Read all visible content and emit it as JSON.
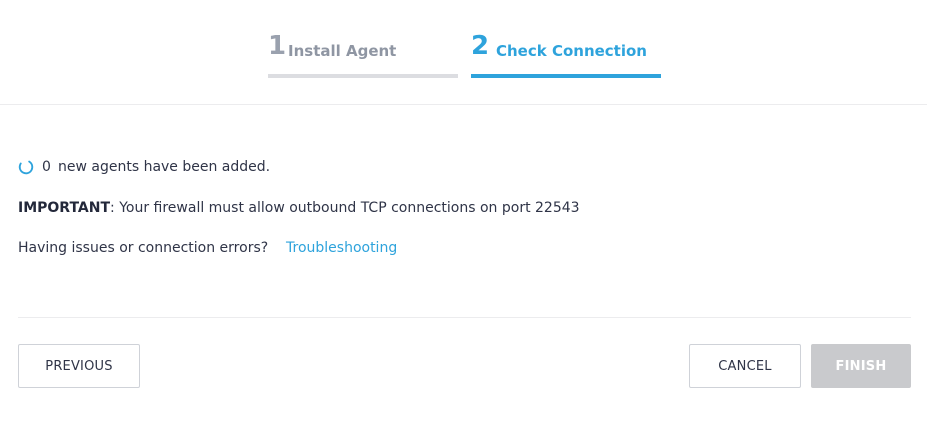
{
  "stepper": {
    "steps": [
      {
        "number": "1",
        "label": "Install Agent",
        "state": "completed"
      },
      {
        "number": "2",
        "label": "Check Connection",
        "state": "active"
      }
    ]
  },
  "status": {
    "agents_count": "0",
    "agents_text": "new agents have been added.",
    "spinner_icon": "loading-spinner-icon"
  },
  "notice": {
    "important_label": "IMPORTANT",
    "important_text": ": Your firewall must allow outbound TCP connections on port 22543"
  },
  "help": {
    "question": "Having issues or connection errors?",
    "link_label": "Troubleshooting"
  },
  "actions": {
    "previous_label": "PREVIOUS",
    "cancel_label": "CANCEL",
    "finish_label": "FINISH",
    "finish_disabled": true
  },
  "colors": {
    "accent": "#2ea3dc",
    "inactive_step": "#8f96a3",
    "disabled_button": "#c9cacd"
  }
}
